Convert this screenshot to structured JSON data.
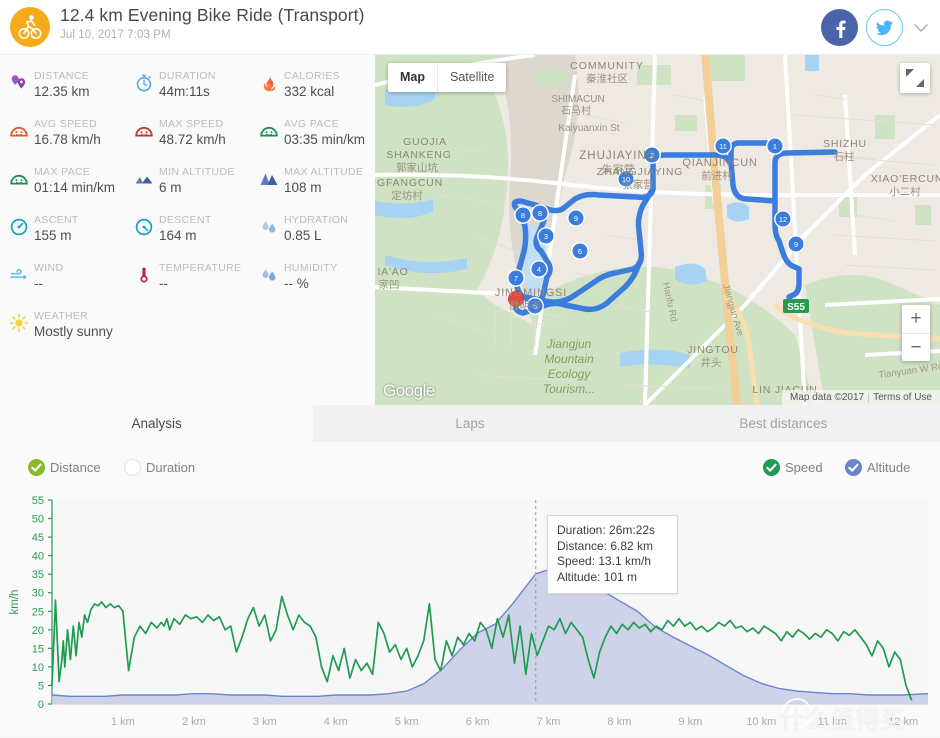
{
  "header": {
    "title": "12.4 km Evening Bike Ride (Transport)",
    "subtitle": "Jul 10, 2017 7:03 PM",
    "avatar_icon": "cyclist-icon",
    "facebook_icon": "facebook-icon",
    "twitter_icon": "twitter-icon",
    "expand_icon": "chevron-down-icon",
    "accent_color": "#f5ab1a",
    "facebook_color": "#4a63a9",
    "twitter_color": "#69c9f2"
  },
  "stats": [
    [
      {
        "label": "DISTANCE",
        "value": "12.35 km",
        "icon": "distance-pin-icon",
        "color": "#9b59b6"
      },
      {
        "label": "DURATION",
        "value": "44m:11s",
        "icon": "stopwatch-icon",
        "color": "#5aa9e6"
      },
      {
        "label": "CALORIES",
        "value": "332 kcal",
        "icon": "flame-icon",
        "color": "#f0623a"
      }
    ],
    [
      {
        "label": "AVG SPEED",
        "value": "16.78 km/h",
        "icon": "speed-gauge-icon",
        "color": "#e8561f"
      },
      {
        "label": "MAX SPEED",
        "value": "48.72 km/h",
        "icon": "speed-gauge-icon",
        "color": "#c0392b"
      },
      {
        "label": "AVG PACE",
        "value": "03:35 min/km",
        "icon": "pace-gauge-icon",
        "color": "#1f8a4c"
      }
    ],
    [
      {
        "label": "MAX PACE",
        "value": "01:14 min/km",
        "icon": "pace-gauge-icon",
        "color": "#1f8a4c"
      },
      {
        "label": "MIN ALTITUDE",
        "value": "6 m",
        "icon": "mountain-icon",
        "color": "#4a6fa5"
      },
      {
        "label": "MAX ALTITUDE",
        "value": "108 m",
        "icon": "mountain-icon",
        "color": "#3f5e9c"
      }
    ],
    [
      {
        "label": "ASCENT",
        "value": "155 m",
        "icon": "ascent-dial-icon",
        "color": "#12a3c4"
      },
      {
        "label": "DESCENT",
        "value": "164 m",
        "icon": "descent-dial-icon",
        "color": "#12a3c4"
      },
      {
        "label": "HYDRATION",
        "value": "0.85 L",
        "icon": "water-drops-icon",
        "color": "#9cc0ef"
      }
    ],
    [
      {
        "label": "WIND",
        "value": "--",
        "icon": "wind-icon",
        "color": "#4fc3d9"
      },
      {
        "label": "TEMPERATURE",
        "value": "--",
        "icon": "thermometer-icon",
        "color": "#b9264f"
      },
      {
        "label": "HUMIDITY",
        "value": "-- %",
        "icon": "humidity-icon",
        "color": "#7ba7e8"
      }
    ],
    [
      {
        "label": "WEATHER",
        "value": "Mostly sunny",
        "icon": "sun-icon",
        "color": "#f5d433"
      }
    ]
  ],
  "map": {
    "type_map_label": "Map",
    "type_satellite_label": "Satellite",
    "selected_type": "Map",
    "fullscreen_icon": "fullscreen-icon",
    "zoom_in_label": "+",
    "zoom_out_label": "−",
    "logo_text": "Google",
    "data_credit": "Map data ©2017",
    "terms_label": "Terms of Use",
    "route_color": "#3b7ddd",
    "marker_color": "#e8453c",
    "waypoints": [
      "1",
      "2",
      "3",
      "4",
      "5",
      "6",
      "7",
      "8",
      "9",
      "10",
      "11",
      "12"
    ],
    "labels": [
      {
        "text": "COMMUNITY",
        "cn": "秦淮社区"
      },
      {
        "text": "ZHUJIAYING",
        "cn": "朱家营"
      },
      {
        "text": "Kaiyuanxin St",
        "cn": ""
      },
      {
        "text": "GUOJIA SHANKENG",
        "cn": "郭家山坑"
      },
      {
        "text": "GFANGCUN",
        "cn": "定坊村"
      },
      {
        "text": "SHIMACUN",
        "cn": "石马村"
      },
      {
        "text": "QIANJINCUN",
        "cn": "前进村"
      },
      {
        "text": "ZHANGJIAYING",
        "cn": "张家营"
      },
      {
        "text": "SHIZHU",
        "cn": "石柱"
      },
      {
        "text": "XIAO'ERCUN",
        "cn": "小二村"
      },
      {
        "text": "JINGMINGSI",
        "cn": "静明寺"
      },
      {
        "text": "JIA'AO",
        "cn": ""
      },
      {
        "text": "Jiangjun Mountain Ecology Tourism...",
        "cn": ""
      },
      {
        "text": "JINGTOU",
        "cn": "井头"
      },
      {
        "text": "LIN JIACUN",
        "cn": ""
      },
      {
        "text": "Hanfu Rd",
        "cn": ""
      },
      {
        "text": "Jiangjun Ave",
        "cn": ""
      },
      {
        "text": "Tianyuan W Rd",
        "cn": ""
      },
      {
        "text": "S55",
        "cn": ""
      }
    ]
  },
  "tabs": [
    {
      "label": "Analysis",
      "active": true
    },
    {
      "label": "Laps",
      "active": false
    },
    {
      "label": "Best distances",
      "active": false
    }
  ],
  "controls": {
    "x_axis": [
      {
        "label": "Distance",
        "checked": true,
        "color": "#8ab82c"
      },
      {
        "label": "Duration",
        "checked": false,
        "color": "#ffffff"
      }
    ],
    "series_toggles": [
      {
        "label": "Speed",
        "checked": true,
        "color": "#1f9b52"
      },
      {
        "label": "Altitude",
        "checked": true,
        "color": "#6b85cc"
      }
    ]
  },
  "tooltip": {
    "duration": "Duration: 26m:22s",
    "distance": "Distance: 6.82 km",
    "speed": "Speed: 13.1 km/h",
    "altitude": "Altitude: 101 m"
  },
  "watermark": {
    "text": "什么值得买",
    "logo": "值"
  },
  "chart_data": {
    "type": "area",
    "title": "",
    "xlabel": "",
    "ylabel": "km/h",
    "ylim": [
      0,
      55
    ],
    "xlim": [
      0,
      12.35
    ],
    "yticks": [
      0,
      5,
      10,
      15,
      20,
      25,
      30,
      35,
      40,
      45,
      50,
      55
    ],
    "xtick_labels": [
      "1 km",
      "2 km",
      "3 km",
      "4 km",
      "5 km",
      "6 km",
      "7 km",
      "8 km",
      "9 km",
      "10 km",
      "11 km",
      "12 km"
    ],
    "xticks": [
      1,
      2,
      3,
      4,
      5,
      6,
      7,
      8,
      9,
      10,
      11,
      12
    ],
    "grid": false,
    "legend": "top-right",
    "cursor_x": 6.82,
    "series": [
      {
        "name": "Speed",
        "unit": "km/h",
        "color": "#1f9b52",
        "kind": "line",
        "x": [
          0.0,
          0.05,
          0.1,
          0.14,
          0.16,
          0.18,
          0.22,
          0.26,
          0.3,
          0.34,
          0.38,
          0.42,
          0.46,
          0.5,
          0.55,
          0.6,
          0.65,
          0.7,
          0.76,
          0.82,
          0.88,
          0.94,
          1.0,
          1.08,
          1.16,
          1.24,
          1.32,
          1.4,
          1.48,
          1.54,
          1.58,
          1.62,
          1.66,
          1.72,
          1.8,
          1.88,
          1.96,
          2.04,
          2.12,
          2.2,
          2.28,
          2.36,
          2.44,
          2.52,
          2.6,
          2.68,
          2.76,
          2.84,
          2.92,
          3.0,
          3.08,
          3.16,
          3.24,
          3.32,
          3.4,
          3.48,
          3.56,
          3.64,
          3.72,
          3.8,
          3.88,
          3.96,
          4.04,
          4.12,
          4.2,
          4.28,
          4.36,
          4.44,
          4.52,
          4.6,
          4.68,
          4.76,
          4.84,
          4.92,
          5.0,
          5.08,
          5.16,
          5.24,
          5.32,
          5.4,
          5.48,
          5.56,
          5.64,
          5.72,
          5.8,
          5.88,
          5.96,
          6.04,
          6.12,
          6.2,
          6.28,
          6.36,
          6.44,
          6.52,
          6.6,
          6.68,
          6.76,
          6.84,
          6.92,
          7.0,
          7.08,
          7.16,
          7.24,
          7.32,
          7.4,
          7.48,
          7.56,
          7.64,
          7.72,
          7.8,
          7.88,
          7.96,
          8.04,
          8.12,
          8.2,
          8.28,
          8.36,
          8.44,
          8.52,
          8.6,
          8.68,
          8.76,
          8.84,
          8.92,
          9.0,
          9.08,
          9.16,
          9.24,
          9.32,
          9.4,
          9.48,
          9.56,
          9.64,
          9.72,
          9.8,
          9.88,
          9.96,
          10.04,
          10.12,
          10.2,
          10.28,
          10.36,
          10.44,
          10.52,
          10.6,
          10.68,
          10.76,
          10.84,
          10.92,
          11.0,
          11.08,
          11.16,
          11.24,
          11.32,
          11.4,
          11.48,
          11.56,
          11.64,
          11.72,
          11.8,
          11.88,
          11.96,
          12.04,
          12.12,
          12.2,
          12.28,
          12.35
        ],
        "values": [
          5.0,
          28.0,
          6.0,
          12.0,
          17.0,
          10.0,
          20.0,
          12.0,
          21.0,
          13.0,
          22.0,
          18.0,
          24.0,
          22.0,
          25.5,
          27.0,
          26.5,
          27.5,
          26.0,
          27.0,
          26.0,
          26.5,
          25.0,
          9.0,
          18.0,
          21.0,
          19.0,
          22.0,
          20.5,
          22.0,
          21.0,
          23.0,
          20.0,
          23.0,
          21.5,
          24.0,
          23.0,
          23.5,
          22.0,
          24.0,
          22.5,
          23.5,
          20.0,
          21.0,
          14.0,
          18.0,
          23.0,
          26.0,
          21.0,
          24.0,
          17.0,
          20.0,
          29.0,
          24.0,
          20.0,
          24.0,
          22.0,
          21.0,
          18.0,
          10.0,
          6.0,
          13.0,
          9.0,
          15.0,
          7.0,
          12.0,
          9.0,
          11.0,
          8.0,
          22.0,
          19.0,
          14.0,
          16.0,
          12.0,
          15.0,
          10.0,
          13.0,
          17.0,
          27.0,
          12.0,
          9.0,
          17.0,
          13.0,
          18.0,
          16.0,
          19.0,
          17.0,
          22.0,
          20.0,
          15.0,
          23.0,
          18.0,
          24.0,
          11.0,
          21.0,
          8.0,
          19.0,
          13.1,
          17.0,
          21.0,
          20.0,
          23.0,
          19.0,
          22.0,
          20.0,
          18.0,
          12.0,
          7.0,
          14.0,
          18.0,
          21.0,
          19.0,
          21.5,
          20.0,
          22.0,
          20.5,
          21.5,
          19.5,
          21.0,
          20.0,
          22.5,
          21.0,
          23.0,
          21.0,
          22.0,
          20.0,
          21.0,
          19.5,
          20.5,
          22.0,
          21.0,
          22.5,
          20.5,
          21.0,
          19.5,
          20.5,
          19.0,
          21.0,
          20.0,
          19.0,
          17.0,
          19.5,
          18.0,
          20.0,
          19.0,
          17.5,
          19.0,
          18.0,
          20.0,
          19.0,
          17.0,
          19.5,
          18.5,
          20.0,
          18.0,
          16.0,
          13.0,
          17.0,
          15.0,
          10.0,
          14.0,
          12.0,
          5.0,
          1.0
        ]
      },
      {
        "name": "Altitude",
        "unit": "m",
        "color": "#6b85cc",
        "fill": "#c8cde6",
        "kind": "area",
        "x": [
          0.0,
          0.25,
          0.5,
          0.75,
          1.0,
          1.25,
          1.5,
          1.75,
          2.0,
          2.25,
          2.5,
          2.75,
          3.0,
          3.25,
          3.5,
          3.75,
          4.0,
          4.25,
          4.5,
          4.75,
          5.0,
          5.25,
          5.5,
          5.75,
          6.0,
          6.25,
          6.5,
          6.82,
          7.0,
          7.25,
          7.5,
          7.75,
          8.0,
          8.25,
          8.5,
          8.75,
          9.0,
          9.25,
          9.5,
          9.75,
          10.0,
          10.25,
          10.5,
          10.75,
          11.0,
          11.25,
          11.5,
          11.75,
          12.0,
          12.35
        ],
        "values": [
          7,
          6,
          6,
          6,
          7,
          7,
          7,
          7,
          8,
          8,
          7,
          7,
          7,
          6,
          6,
          6,
          7,
          7,
          7,
          8,
          10,
          16,
          27,
          42,
          55,
          62,
          78,
          101,
          104,
          103,
          96,
          88,
          80,
          72,
          60,
          52,
          45,
          38,
          30,
          22,
          16,
          12,
          10,
          9,
          8,
          8,
          7,
          7,
          7,
          8
        ]
      }
    ]
  }
}
